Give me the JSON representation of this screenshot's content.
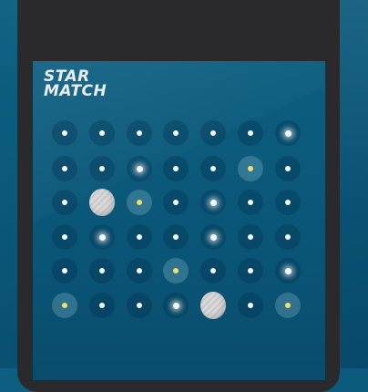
{
  "game": {
    "title_line1": "STAR",
    "title_line2": "MATCH"
  },
  "board": {
    "rows": 6,
    "cols": 7,
    "cells": [
      [
        "dot",
        "dot",
        "dot",
        "dot",
        "dot",
        "dot",
        "glow"
      ],
      [
        "dot",
        "dot",
        "glow",
        "dot",
        "dot",
        "yellow",
        "dot"
      ],
      [
        "dot",
        "moon",
        "yellow",
        "dot",
        "glow",
        "dot",
        "dot"
      ],
      [
        "dot",
        "glow",
        "dot",
        "dot",
        "glow",
        "dot",
        "dot"
      ],
      [
        "dot",
        "dot",
        "dot",
        "yellow",
        "dot",
        "dot",
        "glow"
      ],
      [
        "yellow",
        "dot",
        "dot",
        "glow",
        "moon",
        "dot",
        "yellow"
      ]
    ]
  },
  "colors": {
    "background": "#0b587a",
    "phone_frame": "#2a2a2c",
    "star": "#f4f7f8",
    "highlight_star": "#f2de6a",
    "moon": "#d9d9d9"
  }
}
